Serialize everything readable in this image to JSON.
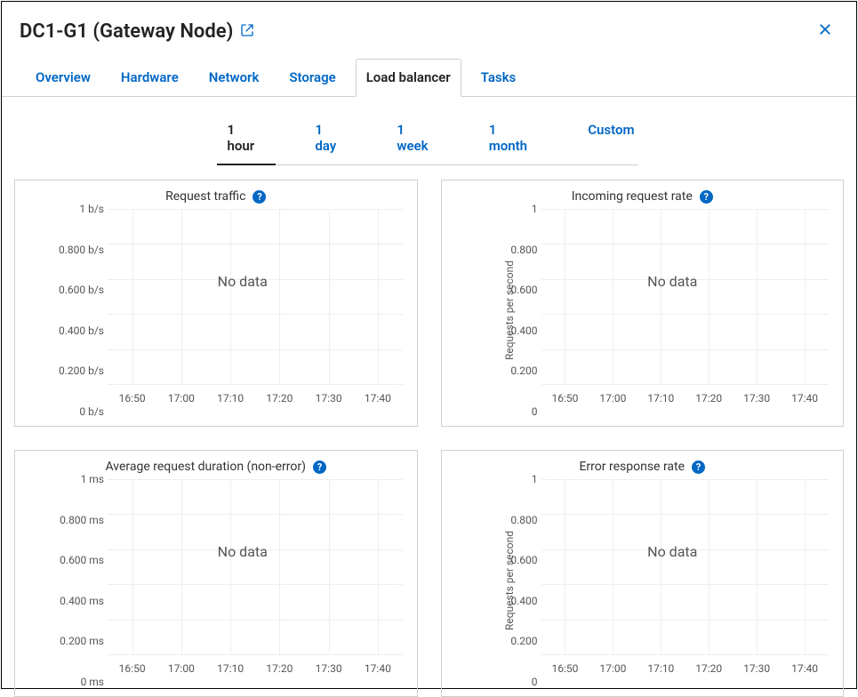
{
  "header": {
    "title": "DC1-G1 (Gateway Node)"
  },
  "tabs": [
    {
      "label": "Overview",
      "active": false
    },
    {
      "label": "Hardware",
      "active": false
    },
    {
      "label": "Network",
      "active": false
    },
    {
      "label": "Storage",
      "active": false
    },
    {
      "label": "Load balancer",
      "active": true
    },
    {
      "label": "Tasks",
      "active": false
    }
  ],
  "ranges": [
    {
      "label": "1 hour",
      "active": true
    },
    {
      "label": "1 day",
      "active": false
    },
    {
      "label": "1 week",
      "active": false
    },
    {
      "label": "1 month",
      "active": false
    },
    {
      "label": "Custom",
      "active": false
    }
  ],
  "nodata_text": "No data",
  "chart_data": [
    {
      "type": "line",
      "title": "Request traffic",
      "ylabel": "",
      "y_ticks": [
        "1 b/s",
        "0.800 b/s",
        "0.600 b/s",
        "0.400 b/s",
        "0.200 b/s",
        "0 b/s"
      ],
      "x_ticks": [
        "16:50",
        "17:00",
        "17:10",
        "17:20",
        "17:30",
        "17:40"
      ],
      "series": [],
      "message": "No data"
    },
    {
      "type": "line",
      "title": "Incoming request rate",
      "ylabel": "Requests per second",
      "y_ticks": [
        "1",
        "0.800",
        "0.600",
        "0.400",
        "0.200",
        "0"
      ],
      "x_ticks": [
        "16:50",
        "17:00",
        "17:10",
        "17:20",
        "17:30",
        "17:40"
      ],
      "series": [],
      "message": "No data"
    },
    {
      "type": "line",
      "title": "Average request duration (non-error)",
      "ylabel": "",
      "y_ticks": [
        "1 ms",
        "0.800 ms",
        "0.600 ms",
        "0.400 ms",
        "0.200 ms",
        "0 ms"
      ],
      "x_ticks": [
        "16:50",
        "17:00",
        "17:10",
        "17:20",
        "17:30",
        "17:40"
      ],
      "series": [],
      "message": "No data"
    },
    {
      "type": "line",
      "title": "Error response rate",
      "ylabel": "Requests per second",
      "y_ticks": [
        "1",
        "0.800",
        "0.600",
        "0.400",
        "0.200",
        "0"
      ],
      "x_ticks": [
        "16:50",
        "17:00",
        "17:10",
        "17:20",
        "17:30",
        "17:40"
      ],
      "series": [],
      "message": "No data"
    }
  ]
}
